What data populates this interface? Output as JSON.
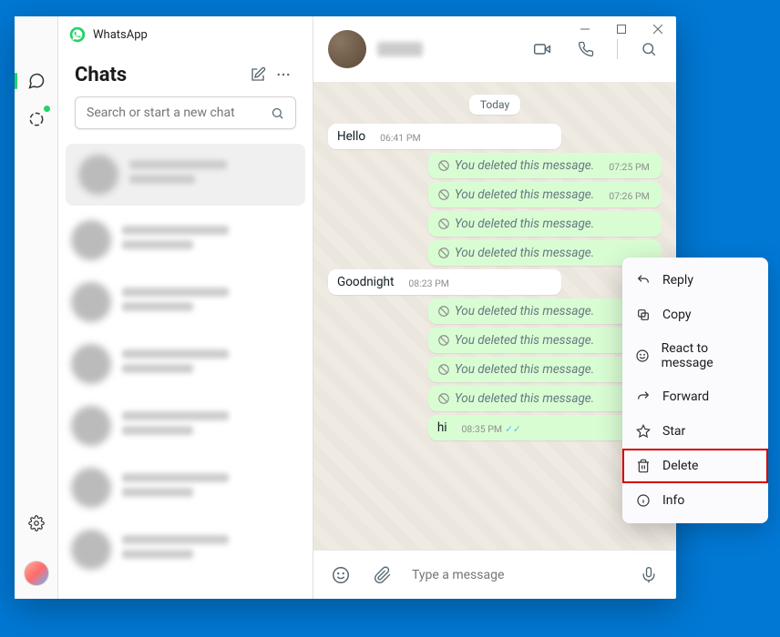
{
  "app": {
    "name": "WhatsApp"
  },
  "sidebar": {
    "title": "Chats",
    "search_placeholder": "Search or start a new chat"
  },
  "conversation": {
    "date_label": "Today",
    "deleted_text": "You deleted this message.",
    "messages": [
      {
        "dir": "in",
        "text": "Hello",
        "time": "06:41 PM"
      },
      {
        "dir": "out",
        "deleted": true,
        "time": "07:25 PM"
      },
      {
        "dir": "out",
        "deleted": true,
        "time": "07:26 PM"
      },
      {
        "dir": "out",
        "deleted": true,
        "time": ""
      },
      {
        "dir": "out",
        "deleted": true,
        "time": ""
      },
      {
        "dir": "in",
        "text": "Goodnight",
        "time": "08:23 PM"
      },
      {
        "dir": "out",
        "deleted": true,
        "time": ""
      },
      {
        "dir": "out",
        "deleted": true,
        "time": ""
      },
      {
        "dir": "out",
        "deleted": true,
        "time": ""
      },
      {
        "dir": "out",
        "deleted": true,
        "time": ""
      },
      {
        "dir": "out",
        "text": "hi",
        "time": "08:35 PM",
        "ticks": true
      }
    ]
  },
  "composer": {
    "placeholder": "Type a message"
  },
  "context_menu": {
    "reply": "Reply",
    "copy": "Copy",
    "react": "React to message",
    "forward": "Forward",
    "star": "Star",
    "delete": "Delete",
    "info": "Info"
  }
}
